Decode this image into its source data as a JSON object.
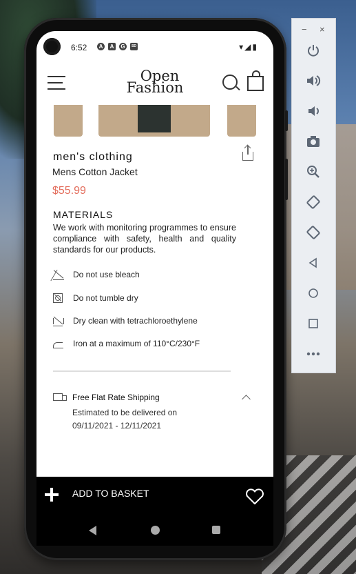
{
  "status_bar": {
    "time": "6:52",
    "left_icons": [
      "A",
      "A",
      "G",
      "SD"
    ],
    "right_icons": "▾◢▮"
  },
  "app_bar": {
    "logo_line1": "Open",
    "logo_line2": "Fashion"
  },
  "product": {
    "category": "men's clothing",
    "name": "Mens Cotton Jacket",
    "price": "$55.99"
  },
  "materials": {
    "title": "MATERIALS",
    "text": "We work with monitoring programmes to ensure compliance with safety, health and quality standards for our products."
  },
  "care": [
    {
      "label": "Do not use bleach",
      "icon": "no-bleach-icon"
    },
    {
      "label": "Do not tumble dry",
      "icon": "no-tumble-dry-icon"
    },
    {
      "label": "Dry clean with tetrachloroethylene",
      "icon": "dry-clean-icon"
    },
    {
      "label": "Iron at a maximum of 110°C/230°F",
      "icon": "iron-icon"
    }
  ],
  "shipping": {
    "title": "Free Flat Rate Shipping",
    "line1": "Estimated to be delivered on",
    "line2": "09/11/2021 - 12/11/2021"
  },
  "bottom_bar": {
    "add_label": "ADD TO BASKET"
  },
  "toolbar": {
    "minimize": "−",
    "close": "×",
    "buttons": [
      "power-icon",
      "volume-up-icon",
      "volume-down-icon",
      "camera-icon",
      "zoom-icon",
      "rotate-left-icon",
      "rotate-right-icon",
      "back-icon",
      "home-icon",
      "overview-icon",
      "more-icon"
    ]
  },
  "colors": {
    "price": "#e36d5c",
    "bottom_bar": "#000000"
  }
}
